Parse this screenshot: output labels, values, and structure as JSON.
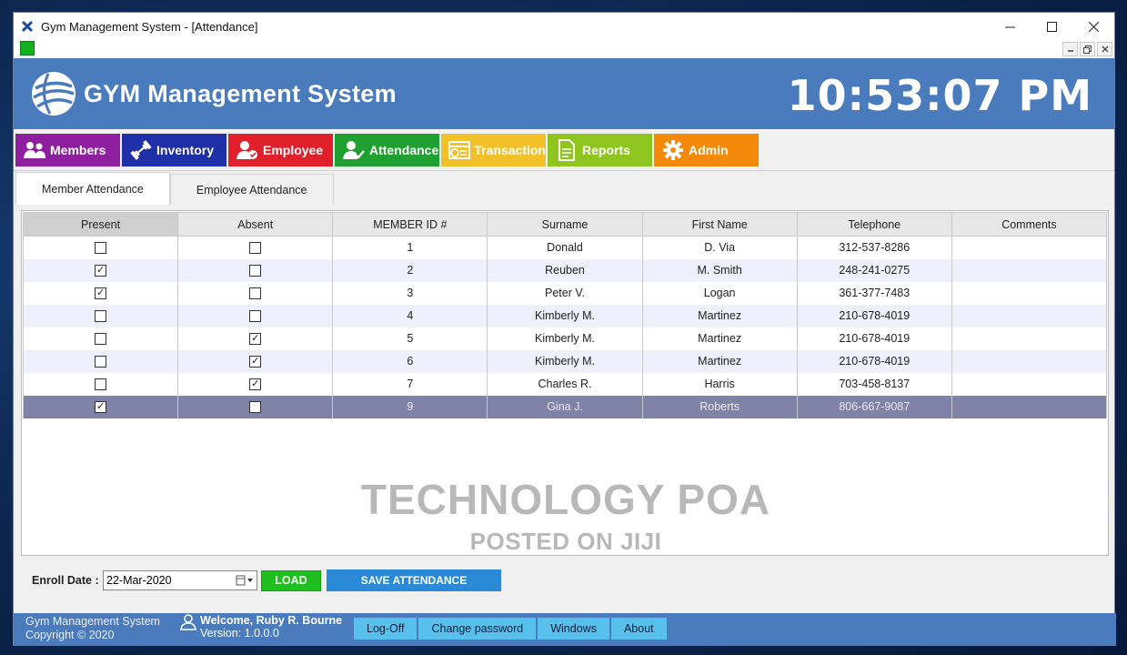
{
  "window": {
    "title": "Gym Management System - [Attendance]",
    "controls": [
      "minimize",
      "maximize",
      "close"
    ]
  },
  "banner": {
    "app_name": "GYM Management System",
    "clock": "10:53:07 PM"
  },
  "nav": [
    {
      "label": "Members",
      "color": "#8e1f9e",
      "icon": "users-icon"
    },
    {
      "label": "Inventory",
      "color": "#1f2fa8",
      "icon": "dumbbell-icon"
    },
    {
      "label": "Employee",
      "color": "#e0202a",
      "icon": "employee-icon"
    },
    {
      "label": "Attendance",
      "color": "#20a030",
      "icon": "attendance-icon"
    },
    {
      "label": "Transaction",
      "color": "#f2c12a",
      "icon": "transaction-icon"
    },
    {
      "label": "Reports",
      "color": "#8ec51e",
      "icon": "reports-icon"
    },
    {
      "label": "Admin",
      "color": "#f58a0a",
      "icon": "gear-icon"
    }
  ],
  "tabs": [
    {
      "label": "Member Attendance",
      "active": true
    },
    {
      "label": "Employee Attendance",
      "active": false
    }
  ],
  "table": {
    "columns": [
      "Present",
      "Absent",
      "MEMBER ID #",
      "Surname",
      "First Name",
      "Telephone",
      "Comments"
    ],
    "rows": [
      {
        "present": false,
        "absent": false,
        "id": "1",
        "surname": "Donald",
        "first": "D. Via",
        "tel": "312-537-8286",
        "comments": ""
      },
      {
        "present": true,
        "absent": false,
        "id": "2",
        "surname": "Reuben",
        "first": "M. Smith",
        "tel": "248-241-0275",
        "comments": ""
      },
      {
        "present": true,
        "absent": false,
        "id": "3",
        "surname": "Peter V.",
        "first": "Logan",
        "tel": "361-377-7483",
        "comments": ""
      },
      {
        "present": false,
        "absent": false,
        "id": "4",
        "surname": "Kimberly M.",
        "first": "Martinez",
        "tel": "210-678-4019",
        "comments": ""
      },
      {
        "present": false,
        "absent": true,
        "id": "5",
        "surname": "Kimberly M.",
        "first": "Martinez",
        "tel": "210-678-4019",
        "comments": ""
      },
      {
        "present": false,
        "absent": true,
        "id": "6",
        "surname": "Kimberly M.",
        "first": "Martinez",
        "tel": "210-678-4019",
        "comments": ""
      },
      {
        "present": false,
        "absent": true,
        "id": "7",
        "surname": "Charles R.",
        "first": "Harris",
        "tel": "703-458-8137",
        "comments": ""
      },
      {
        "present": true,
        "absent": false,
        "id": "9",
        "surname": "Gina J.",
        "first": "Roberts",
        "tel": "806-667-9087",
        "comments": "",
        "selected": true
      }
    ]
  },
  "watermark": {
    "line1": "TECHNOLOGY POA",
    "line2": "POSTED ON JIJI"
  },
  "controls": {
    "enroll_label": "Enroll Date :",
    "enroll_date": "22-Mar-2020",
    "load_label": "LOAD",
    "save_label": "SAVE ATTENDANCE"
  },
  "statusbar": {
    "app_name": "Gym Management System",
    "copyright": "Copyright  © 2020",
    "welcome": "Welcome, Ruby R. Bourne",
    "version": "Version: 1.0.0.0",
    "links": [
      "Log-Off",
      "Change password",
      "Windows",
      "About"
    ]
  }
}
